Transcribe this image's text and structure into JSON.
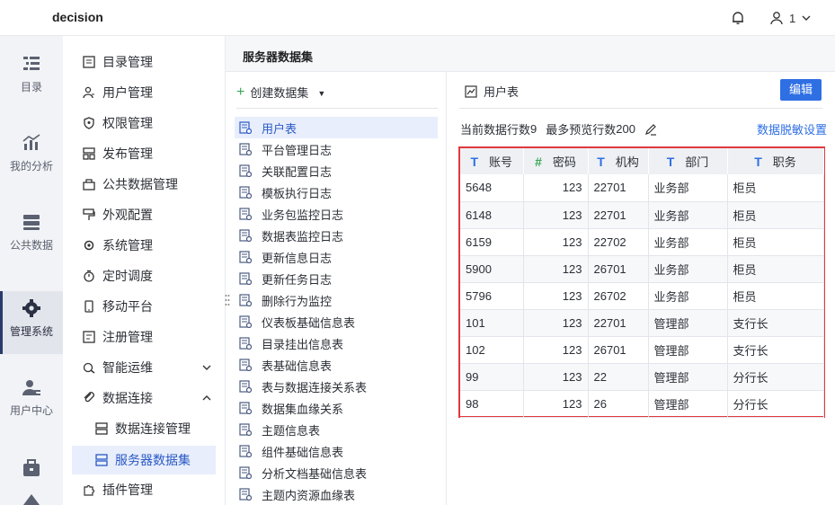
{
  "app": {
    "brand": "decision",
    "user": "1"
  },
  "rail": [
    {
      "label": "目录",
      "icon": "catalog-icon"
    },
    {
      "label": "我的分析",
      "icon": "analysis-icon"
    },
    {
      "label": "公共数据",
      "icon": "public-data-icon"
    },
    {
      "label": "管理系统",
      "icon": "management-gear-icon",
      "active": true
    },
    {
      "label": "用户中心",
      "icon": "user-center-icon"
    }
  ],
  "menu": {
    "items": [
      {
        "label": "目录管理",
        "icon": "catalog-manage-icon"
      },
      {
        "label": "用户管理",
        "icon": "user-manage-icon"
      },
      {
        "label": "权限管理",
        "icon": "permission-icon"
      },
      {
        "label": "发布管理",
        "icon": "publish-icon"
      },
      {
        "label": "公共数据管理",
        "icon": "public-data-manage-icon"
      },
      {
        "label": "外观配置",
        "icon": "appearance-icon"
      },
      {
        "label": "系统管理",
        "icon": "system-gear-icon"
      },
      {
        "label": "定时调度",
        "icon": "timer-icon"
      },
      {
        "label": "移动平台",
        "icon": "mobile-icon"
      },
      {
        "label": "注册管理",
        "icon": "register-icon"
      },
      {
        "label": "智能运维",
        "icon": "ops-icon"
      },
      {
        "label": "数据连接",
        "icon": "data-connection-icon"
      },
      {
        "label": "数据连接管理",
        "icon": "connection-manage-icon"
      },
      {
        "label": "服务器数据集",
        "icon": "server-dataset-icon"
      },
      {
        "label": "插件管理",
        "icon": "plugin-icon"
      }
    ]
  },
  "content": {
    "header": "服务器数据集"
  },
  "datasets": {
    "create_label": "创建数据集",
    "items": [
      "用户表",
      "平台管理日志",
      "关联配置日志",
      "模板执行日志",
      "业务包监控日志",
      "数据表监控日志",
      "更新信息日志",
      "更新任务日志",
      "删除行为监控",
      "仪表板基础信息表",
      "目录挂出信息表",
      "表基础信息表",
      "表与数据连接关系表",
      "数据集血缘关系",
      "主题信息表",
      "组件基础信息表",
      "分析文档基础信息表",
      "主题内资源血缘表"
    ]
  },
  "detail": {
    "title": "用户表",
    "edit_label": "编辑",
    "stats_rows_label": "当前数据行数",
    "stats_rows_value": "9",
    "stats_preview_label": "最多预览行数",
    "stats_preview_value": "200",
    "desens_label": "数据脱敏设置",
    "table": {
      "columns": [
        {
          "label": "账号",
          "type": "T"
        },
        {
          "label": "密码",
          "type": "#"
        },
        {
          "label": "机构",
          "type": "T"
        },
        {
          "label": "部门",
          "type": "T"
        },
        {
          "label": "职务",
          "type": "T"
        }
      ],
      "rows": [
        [
          "5648",
          "123",
          "22701",
          "业务部",
          "柜员"
        ],
        [
          "6148",
          "123",
          "22701",
          "业务部",
          "柜员"
        ],
        [
          "6159",
          "123",
          "22702",
          "业务部",
          "柜员"
        ],
        [
          "5900",
          "123",
          "26701",
          "业务部",
          "柜员"
        ],
        [
          "5796",
          "123",
          "26702",
          "业务部",
          "柜员"
        ],
        [
          "101",
          "123",
          "22701",
          "管理部",
          "支行长"
        ],
        [
          "102",
          "123",
          "26701",
          "管理部",
          "支行长"
        ],
        [
          "99",
          "123",
          "22",
          "管理部",
          "分行长"
        ],
        [
          "98",
          "123",
          "26",
          "管理部",
          "分行长"
        ]
      ]
    }
  }
}
